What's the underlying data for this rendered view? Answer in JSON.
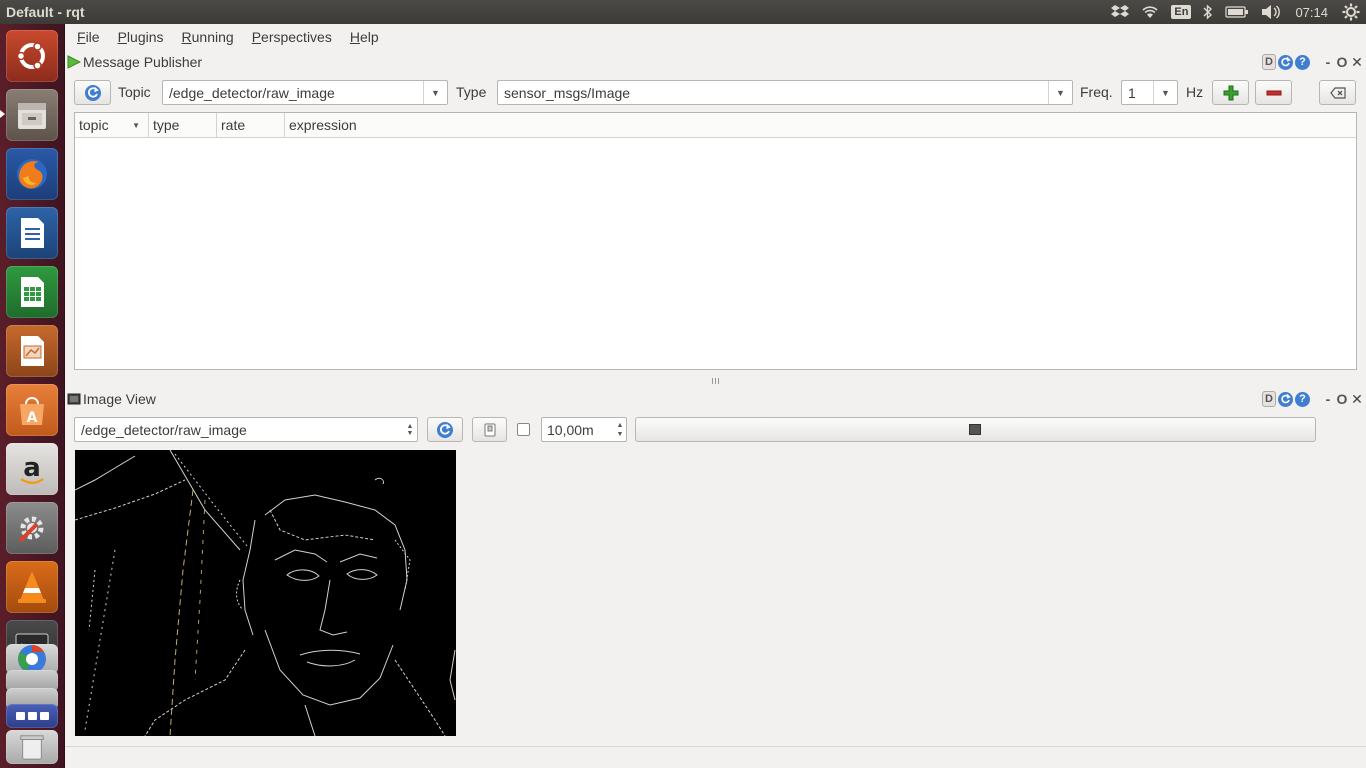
{
  "window": {
    "title": "Default - rqt"
  },
  "panel": {
    "indicators": [
      "dropbox-icon",
      "wifi-icon",
      "keyboard-layout",
      "bluetooth-icon",
      "battery-icon",
      "volume-icon",
      "clock",
      "settings-icon"
    ],
    "language": "En",
    "clock": "07:14"
  },
  "launcher": {
    "apps": [
      "Ubuntu Dash",
      "Files",
      "Firefox",
      "LibreOffice Writer",
      "LibreOffice Calc",
      "LibreOffice Impress",
      "Ubuntu Software Center",
      "Amazon",
      "System Settings",
      "VLC",
      "Terminal",
      "Chromium",
      "Workspaces",
      "Trash"
    ]
  },
  "menubar": {
    "items": [
      {
        "label": "File",
        "mnemonic": "F"
      },
      {
        "label": "Plugins",
        "mnemonic": "P"
      },
      {
        "label": "Running",
        "mnemonic": "R"
      },
      {
        "label": "Perspectives",
        "mnemonic": "P"
      },
      {
        "label": "Help",
        "mnemonic": "H"
      }
    ]
  },
  "message_publisher": {
    "title": "Message Publisher",
    "dock_buttons": {
      "detach": "D",
      "refresh": "C",
      "help": "?",
      "minimize": "-",
      "float": "O",
      "close": "✕"
    },
    "topic_label": "Topic",
    "topic_value": "/edge_detector/raw_image",
    "type_label": "Type",
    "type_value": "sensor_msgs/Image",
    "freq_label": "Freq.",
    "freq_value": "1",
    "hz_label": "Hz",
    "columns": [
      "topic",
      "type",
      "rate",
      "expression"
    ]
  },
  "image_view": {
    "title": "Image View",
    "dock_buttons": {
      "detach": "D",
      "refresh": "C",
      "help": "?",
      "minimize": "-",
      "float": "O",
      "close": "✕"
    },
    "topic_value": "/edge_detector/raw_image",
    "max_range_value": "10,00m",
    "checkbox_checked": false
  },
  "colors": {
    "launcher_bg": "#4a1822",
    "panel_bg": "#3c3b37",
    "accent_blue": "#3f7ed0",
    "add_green": "#3aa12d",
    "remove_red": "#cc2d2d"
  }
}
